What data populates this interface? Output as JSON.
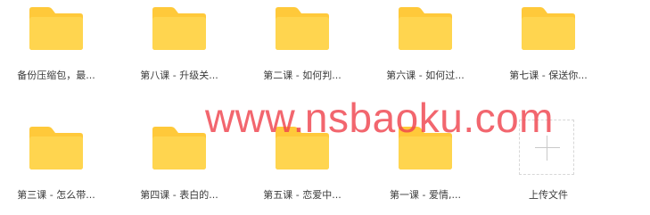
{
  "colors": {
    "folder_body": "#FFD54F",
    "folder_tab": "#FFC93A",
    "watermark": "#EF444E",
    "label_text": "#3B3B3B",
    "upload_border": "#D7D7D7"
  },
  "icons": {
    "folder": "folder-icon",
    "upload": "plus-icon"
  },
  "files": [
    {
      "name": "备份压缩包，最..."
    },
    {
      "name": "第八课 - 升级关..."
    },
    {
      "name": "第二课 - 如何判..."
    },
    {
      "name": "第六课 - 如何过..."
    },
    {
      "name": "第七课 - 保送你..."
    },
    {
      "name": "第三课 - 怎么带..."
    },
    {
      "name": "第四课 - 表白的..."
    },
    {
      "name": "第五课 - 恋爱中..."
    },
    {
      "name": "第一课 - 爱情,..."
    }
  ],
  "upload": {
    "label": "上传文件"
  },
  "watermark": {
    "text": "www.nsbaoku.com"
  }
}
